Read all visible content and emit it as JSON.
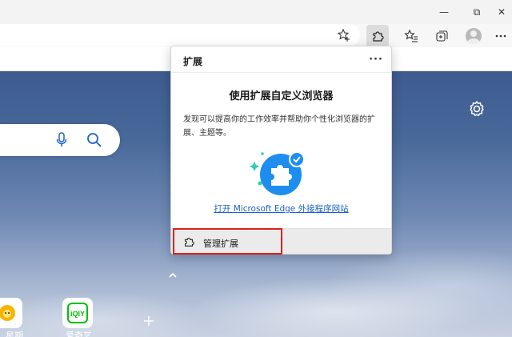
{
  "window_controls": {
    "minimize": "—",
    "restore": "⧉",
    "close": "✕"
  },
  "toolbar": {
    "icons": [
      "add-to-favorites-icon",
      "extensions-icon",
      "favorites-icon",
      "collections-icon",
      "profile-avatar",
      "settings-and-more-icon"
    ]
  },
  "extensions_popup": {
    "title": "扩展",
    "more_label": "···",
    "heading": "使用扩展自定义浏览器",
    "description": "发现可以提高你的工作效率并帮助你个性化浏览器的扩展、主题等。",
    "link": "打开 Microsoft Edge 外接程序网站",
    "manage_label": "管理扩展"
  },
  "new_tab": {
    "quick_links": [
      {
        "label": "…星期",
        "icon": "sunflower-icon"
      },
      {
        "label": "爱奇艺",
        "icon": "iqiyi-icon"
      }
    ]
  },
  "colors": {
    "accent": "#1a62c6",
    "highlight": "#e02020",
    "puzzle": "#1d8ef0"
  }
}
